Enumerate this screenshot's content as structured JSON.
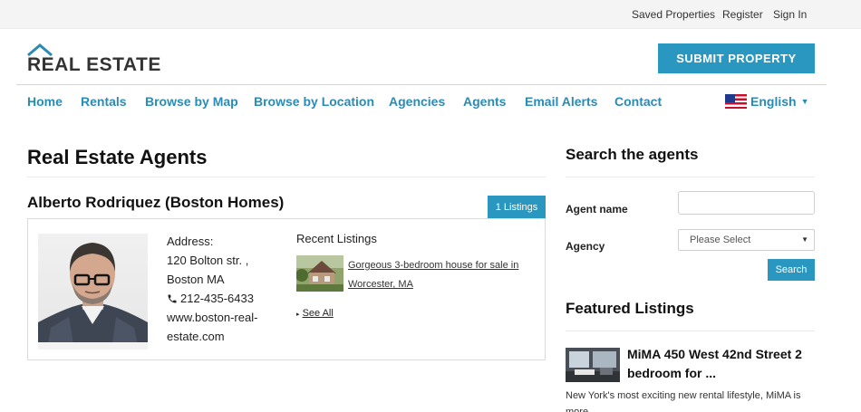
{
  "topbar": {
    "saved_properties": "Saved Properties",
    "register": "Register",
    "sign_in": "Sign In"
  },
  "header": {
    "logo_text": "REAL ESTATE",
    "submit_button": "SUBMIT PROPERTY"
  },
  "nav": {
    "items": [
      "Home",
      "Rentals",
      "Browse by Map",
      "Browse by Location",
      "Agencies",
      "Agents",
      "Email Alerts",
      "Contact"
    ],
    "language": "English"
  },
  "main": {
    "page_title": "Real Estate Agents",
    "agent": {
      "name": "Alberto Rodriquez (Boston Homes)",
      "listings_badge": "1 Listings",
      "address_label": "Address:",
      "address_line1": "120 Bolton str. ,",
      "address_line2": "Boston MA",
      "phone": "212-435-6433",
      "website_line1": "www.boston-real-",
      "website_line2": "estate.com",
      "recent_title": "Recent Listings",
      "recent_listing": "Gorgeous 3-bedroom house for sale in Worcester, MA",
      "see_all": "See All"
    }
  },
  "sidebar": {
    "search_title": "Search the agents",
    "agent_name_label": "Agent name",
    "agent_name_value": "",
    "agency_label": "Agency",
    "agency_selected": "Please Select",
    "search_button": "Search",
    "featured_title": "Featured Listings",
    "featured_item_title": "MiMA 450 West 42nd Street 2 bedroom for ...",
    "featured_item_desc": "New York's most exciting new rental lifestyle, MiMA is more"
  },
  "colors": {
    "accent": "#2a97c0",
    "nav_link": "#2a8bb5"
  }
}
